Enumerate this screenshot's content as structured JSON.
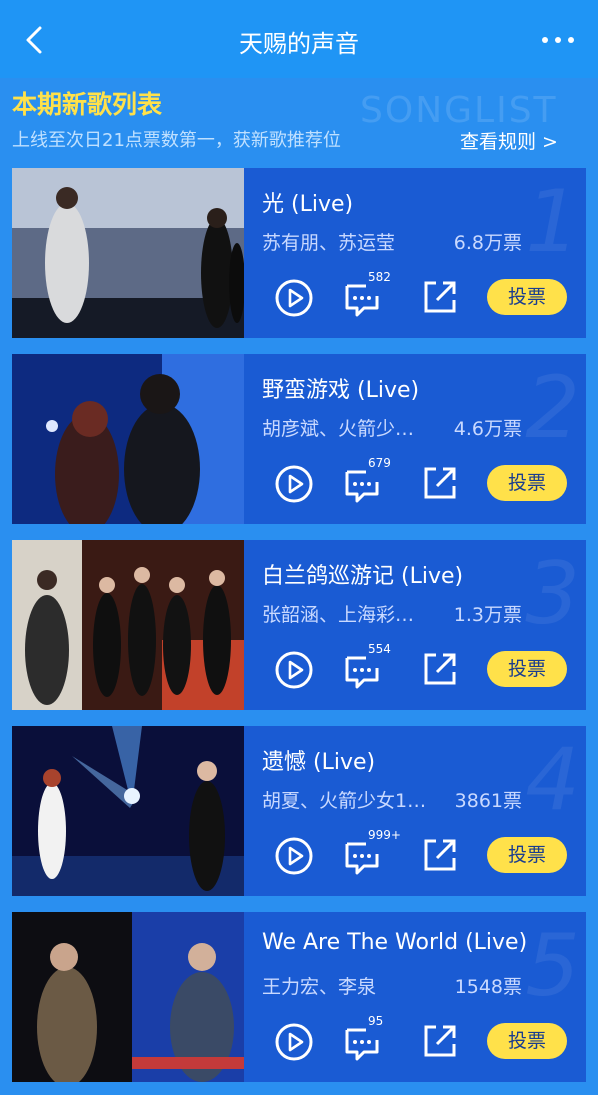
{
  "header": {
    "title": "天赐的声音"
  },
  "section": {
    "title": "本期新歌列表",
    "bg_word": "SONGLIST",
    "subtitle": "上线至次日21点票数第一，获新歌推荐位",
    "rules_link": "查看规则 >"
  },
  "songs": [
    {
      "rank": "1",
      "title": "光 (Live)",
      "artists": "苏有朋、苏运莹",
      "votes": "6.8万票",
      "comments": "582",
      "vote_label": "投票"
    },
    {
      "rank": "2",
      "title": "野蛮游戏 (Live)",
      "artists": "胡彦斌、火箭少…",
      "votes": "4.6万票",
      "comments": "679",
      "vote_label": "投票"
    },
    {
      "rank": "3",
      "title": "白兰鸽巡游记 (Live)",
      "artists": "张韶涵、上海彩…",
      "votes": "1.3万票",
      "comments": "554",
      "vote_label": "投票"
    },
    {
      "rank": "4",
      "title": "遗憾 (Live)",
      "artists": "胡夏、火箭少女1…",
      "votes": "3861票",
      "comments": "999+",
      "vote_label": "投票"
    },
    {
      "rank": "5",
      "title": "We Are The World (Live)",
      "artists": "王力宏、李泉",
      "votes": "1548票",
      "comments": "95",
      "vote_label": "投票"
    }
  ],
  "colors": {
    "topbar": "#1f95f5",
    "background": "#2a8ff0",
    "card": "#1a5bd3",
    "accent_yellow": "#ffe14a"
  }
}
